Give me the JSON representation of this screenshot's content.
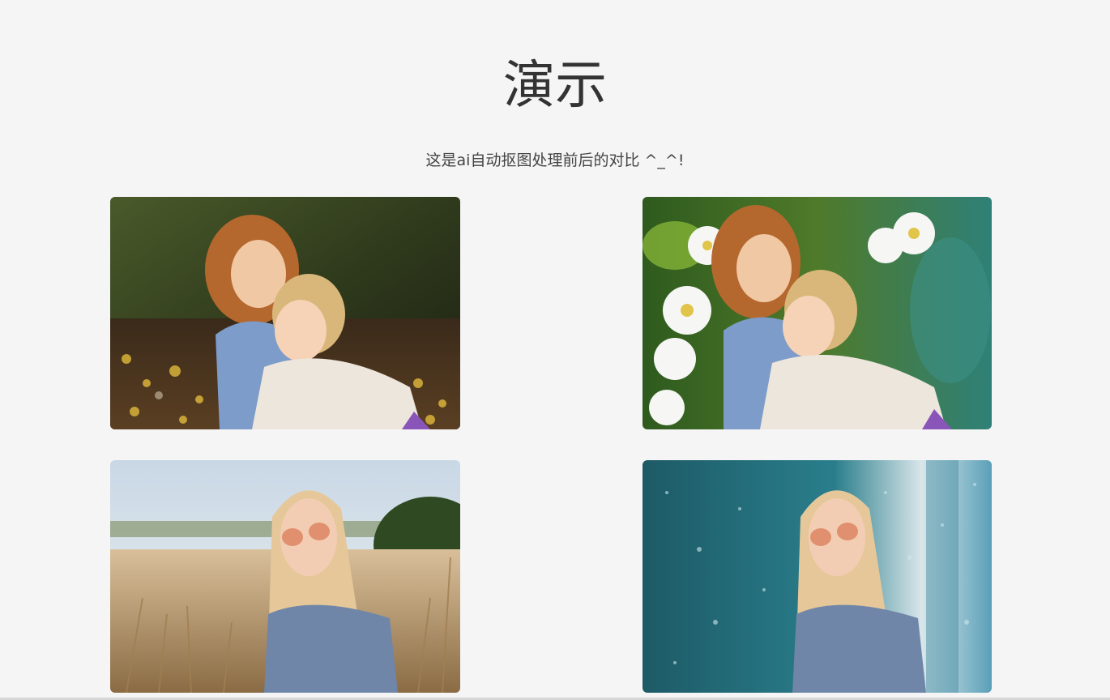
{
  "header": {
    "title": "演示",
    "subtitle": "这是ai自动抠图处理前后的对比 ^_^!"
  },
  "gallery": {
    "images": [
      {
        "name": "kids-hug-original"
      },
      {
        "name": "kids-hug-flowers-background"
      },
      {
        "name": "girl-wheat-field-original"
      },
      {
        "name": "girl-rainy-window-background"
      }
    ]
  }
}
